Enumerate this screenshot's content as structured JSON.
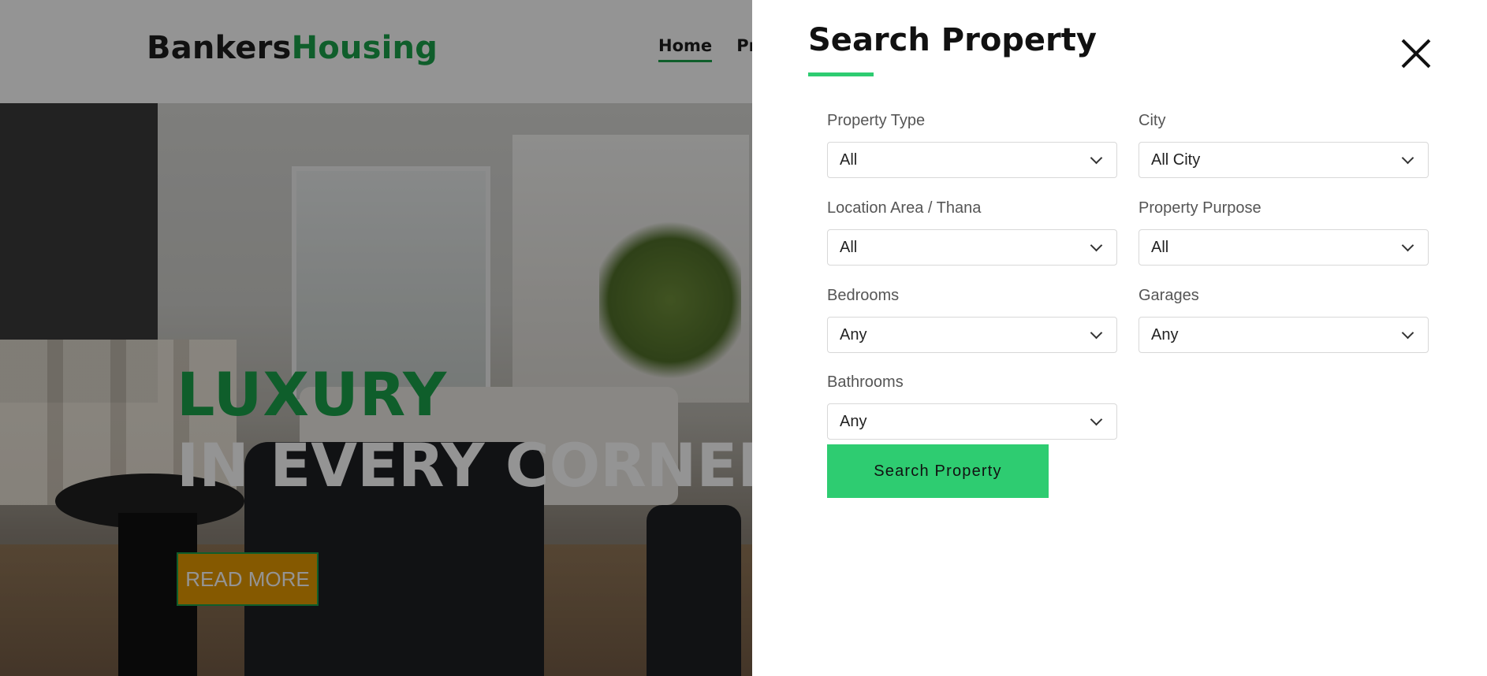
{
  "header": {
    "logo_part1": "Bankers",
    "logo_part2": "Housing",
    "nav": [
      {
        "label": "Home",
        "active": true
      },
      {
        "label": "Pr",
        "active": false
      }
    ]
  },
  "hero": {
    "line1": "LUXURY",
    "line2": "IN EVERY CORNER",
    "button": "READ MORE"
  },
  "panel": {
    "title": "Search Property",
    "close_icon": "close-icon",
    "fields": {
      "property_type": {
        "label": "Property Type",
        "value": "All"
      },
      "city": {
        "label": "City",
        "value": "All City"
      },
      "location": {
        "label": "Location Area / Thana",
        "value": "All"
      },
      "purpose": {
        "label": "Property Purpose",
        "value": "All"
      },
      "bedrooms": {
        "label": "Bedrooms",
        "value": "Any"
      },
      "garages": {
        "label": "Garages",
        "value": "Any"
      },
      "bathrooms": {
        "label": "Bathrooms",
        "value": "Any"
      }
    },
    "submit": "Search Property"
  },
  "colors": {
    "brand_green": "#1aa34a",
    "button_green": "#2ecc71",
    "accent_orange": "#e69a00"
  }
}
